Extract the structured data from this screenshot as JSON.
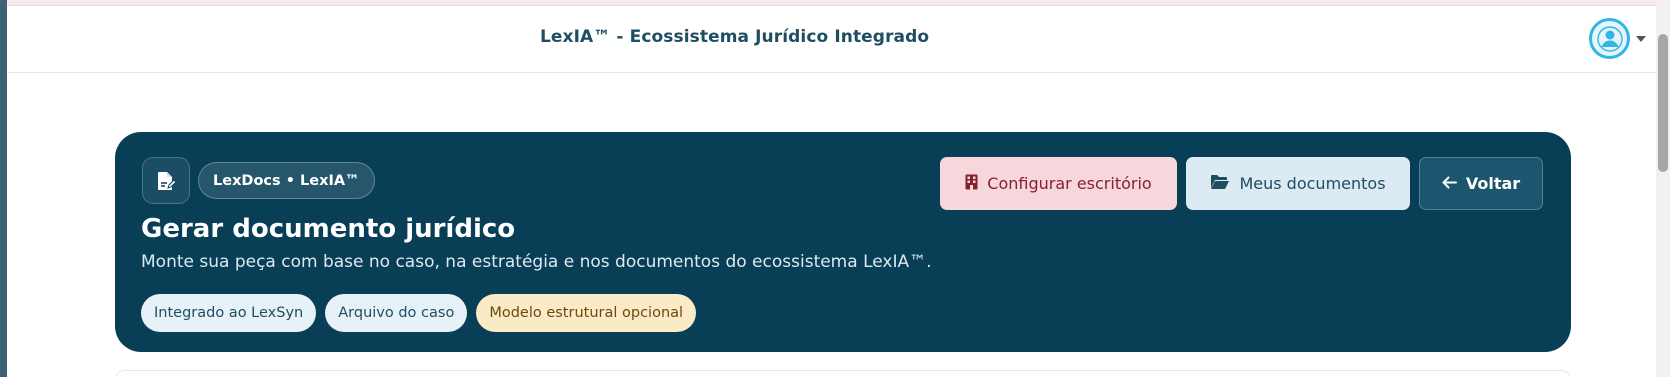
{
  "header": {
    "title": "LexIA™ - Ecossistema Jurídico Integrado",
    "user_icon": "user-avatar-icon",
    "menu_icon": "caret-down-icon"
  },
  "hero": {
    "doc_icon": "document-edit-icon",
    "badge": "LexDocs • LexIA™",
    "title": "Gerar documento jurídico",
    "subtitle": "Monte sua peça com base no caso, na estratégia e nos documentos do ecossistema LexIA™.",
    "chips": [
      {
        "label": "Integrado ao LexSyn"
      },
      {
        "label": "Arquivo do caso"
      },
      {
        "label": "Modelo estrutural opcional"
      }
    ],
    "buttons": {
      "config": {
        "label": "Configurar escritório",
        "icon": "building-icon"
      },
      "docs": {
        "label": "Meus documentos",
        "icon": "folder-open-icon"
      },
      "back": {
        "label": "Voltar",
        "icon": "arrow-left-icon"
      }
    }
  },
  "colors": {
    "hero_bg": "#083f57",
    "config_bg": "#f6d7dc",
    "docs_bg": "#dceaf4",
    "accent": "#31b6e6"
  }
}
